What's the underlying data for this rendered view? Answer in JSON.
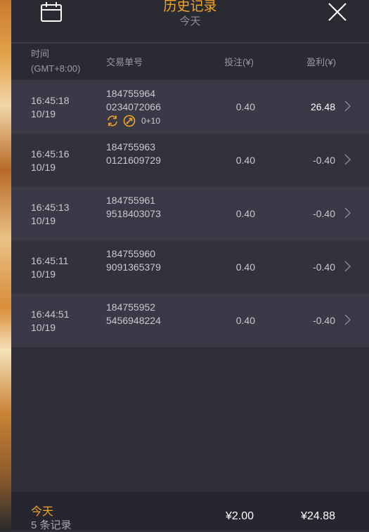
{
  "header": {
    "title": "历史记录",
    "subtitle": "今天",
    "calendar_icon": "calendar-icon",
    "close_icon": "close-icon"
  },
  "columns": {
    "time_line1": "时间",
    "time_line2": "(GMT+8:00)",
    "trade_no": "交易单号",
    "bet": "投注(¥)",
    "profit": "盈利(¥)"
  },
  "rows": [
    {
      "time": "16:45:18",
      "date": "10/19",
      "trade_a": "184755964",
      "trade_b": "0234072066",
      "extra": "0+10",
      "bet": "0.40",
      "profit": "26.48"
    },
    {
      "time": "16:45:16",
      "date": "10/19",
      "trade_a": "184755963",
      "trade_b": "0121609729",
      "bet": "0.40",
      "profit": "-0.40"
    },
    {
      "time": "16:45:13",
      "date": "10/19",
      "trade_a": "184755961",
      "trade_b": "9518403073",
      "bet": "0.40",
      "profit": "-0.40"
    },
    {
      "time": "16:45:11",
      "date": "10/19",
      "trade_a": "184755960",
      "trade_b": "9091365379",
      "bet": "0.40",
      "profit": "-0.40"
    },
    {
      "time": "16:44:51",
      "date": "10/19",
      "trade_a": "184755952",
      "trade_b": "5456948224",
      "bet": "0.40",
      "profit": "-0.40"
    }
  ],
  "footer": {
    "label": "今天",
    "count": "5 条记录",
    "total_bet": "¥2.00",
    "total_profit": "¥24.88"
  },
  "colors": {
    "accent": "#f5a623",
    "panel": "#2f2f39",
    "row_light": "#393947",
    "row_dark": "#32323d"
  }
}
